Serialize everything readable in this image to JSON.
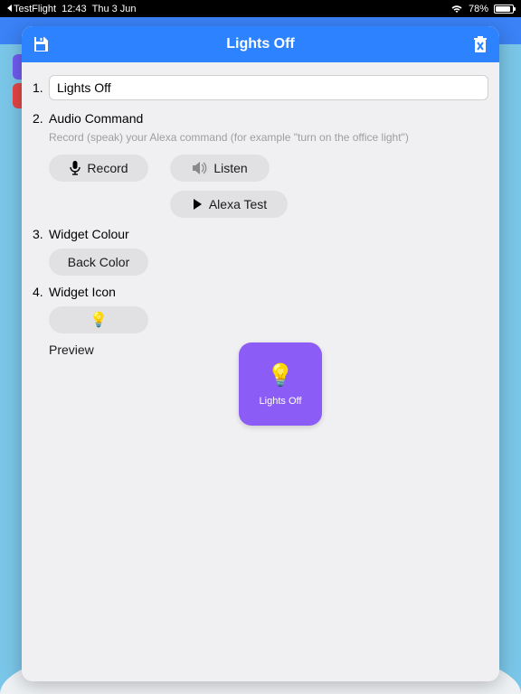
{
  "status": {
    "back_app": "TestFlight",
    "time": "12:43",
    "date": "Thu 3 Jun",
    "battery_pct": "78%",
    "battery_fill_pct": 78
  },
  "modal": {
    "title": "Lights Off"
  },
  "step1": {
    "num": "1.",
    "value": "Lights Off"
  },
  "step2": {
    "num": "2.",
    "label": "Audio Command",
    "hint": "Record (speak) your Alexa command (for example \"turn on the office light\")",
    "record_btn": "Record",
    "listen_btn": "Listen",
    "alexa_test_btn": "Alexa Test"
  },
  "step3": {
    "num": "3.",
    "label": "Widget Colour",
    "back_color_btn": "Back Color"
  },
  "step4": {
    "num": "4.",
    "label": "Widget Icon"
  },
  "preview": {
    "label": "Preview",
    "tile_label": "Lights Off",
    "tile_color": "#8b5cf6"
  },
  "icons": {
    "bulb": "💡"
  }
}
